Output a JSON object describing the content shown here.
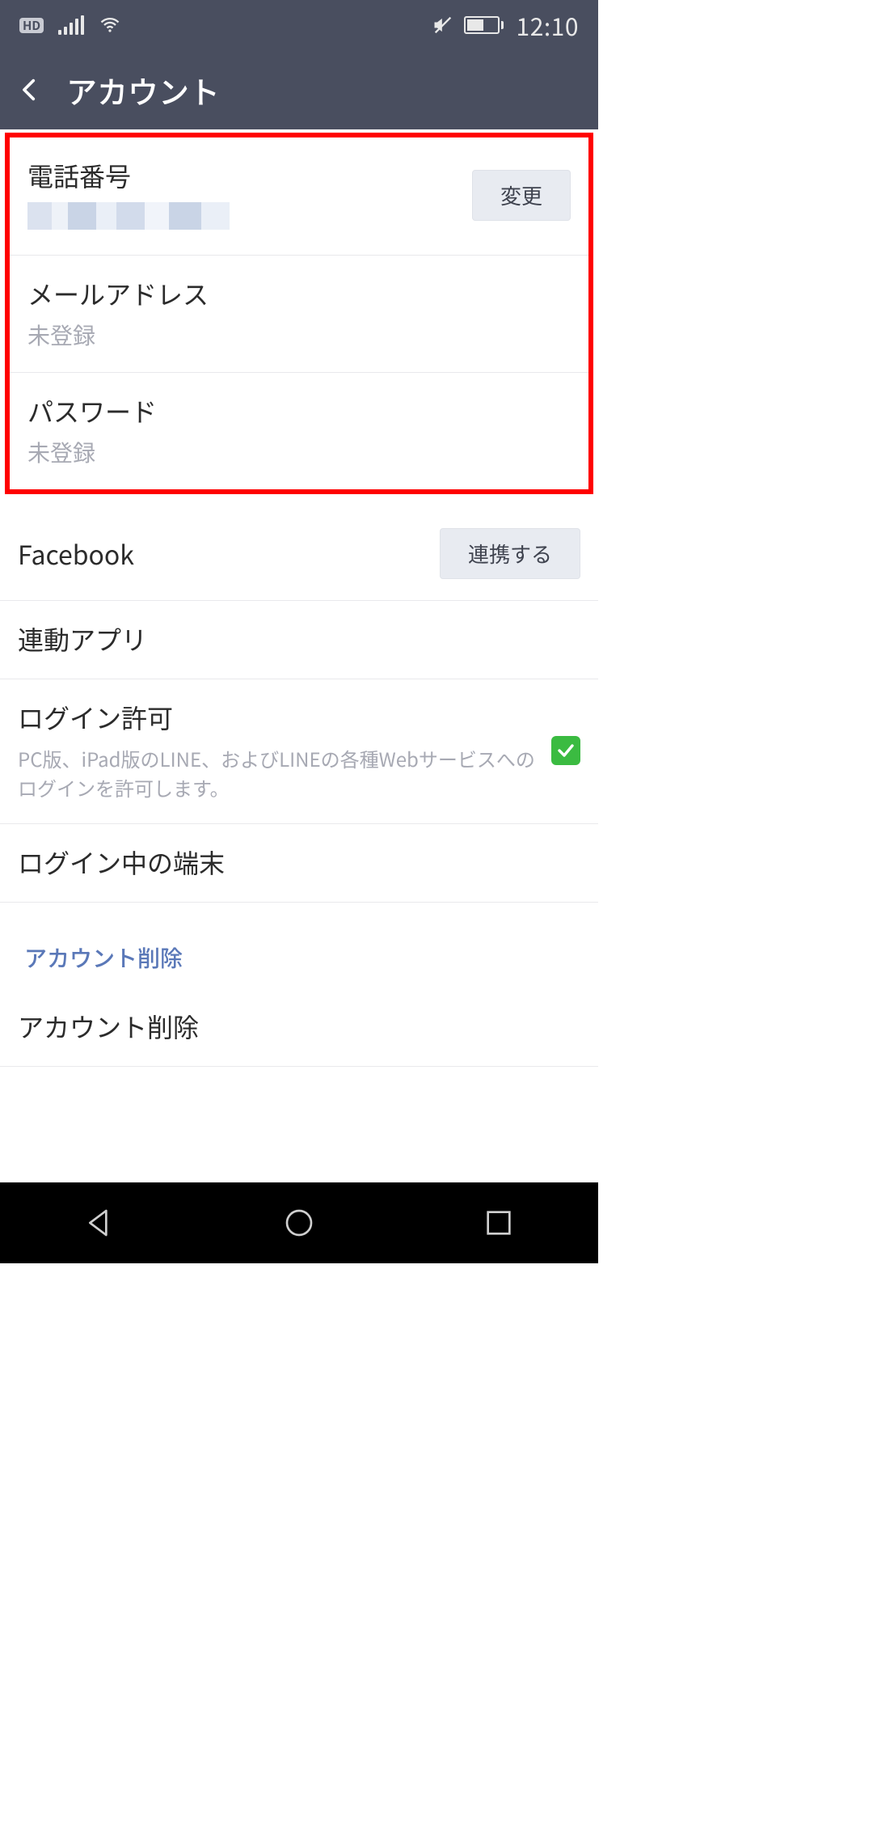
{
  "status": {
    "hd": "HD",
    "time": "12:10"
  },
  "header": {
    "title": "アカウント"
  },
  "rows": {
    "phone": {
      "label": "電話番号",
      "change_btn": "変更"
    },
    "email": {
      "label": "メールアドレス",
      "value": "未登録"
    },
    "password": {
      "label": "パスワード",
      "value": "未登録"
    },
    "facebook": {
      "label": "Facebook",
      "link_btn": "連携する"
    },
    "linked_apps": {
      "label": "連動アプリ"
    },
    "login_permission": {
      "label": "ログイン許可",
      "desc": "PC版、iPad版のLINE、およびLINEの各種Webサービスへのログインを許可します。",
      "checked": true
    },
    "logged_in_devices": {
      "label": "ログイン中の端末"
    }
  },
  "sections": {
    "delete_header": "アカウント削除",
    "delete_row": "アカウント削除"
  }
}
